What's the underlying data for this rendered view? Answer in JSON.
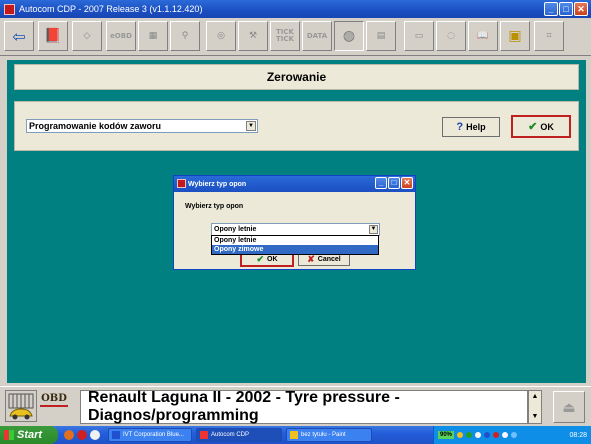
{
  "window": {
    "title": "Autocom CDP  -  2007 Release 3  (v1.1.12.420)",
    "minimize_label": "_",
    "maximize_label": "□",
    "close_label": "✕"
  },
  "toolbar": {
    "tools": [
      {
        "name": "back-arrow-icon",
        "label": "⇦"
      },
      {
        "name": "book-icon",
        "label": "📕"
      },
      {
        "name": "eraser-icon",
        "label": "◇"
      },
      {
        "name": "eobd-icon",
        "label": "eOBD"
      },
      {
        "name": "ecu-icon",
        "label": "▦"
      },
      {
        "name": "stamp-icon",
        "label": "⚲"
      },
      {
        "name": "disc-icon",
        "label": "◎"
      },
      {
        "name": "wrench-icon",
        "label": "⚒"
      },
      {
        "name": "tick-tick-icon",
        "label": "TICK TICK"
      },
      {
        "name": "data-icon",
        "label": "DATA"
      },
      {
        "name": "tire-icon",
        "label": "◍"
      },
      {
        "name": "keypad-icon",
        "label": "▤"
      },
      {
        "name": "save-icon",
        "label": "▭"
      },
      {
        "name": "cd-icon",
        "label": "◌"
      },
      {
        "name": "manual-icon",
        "label": "📖"
      },
      {
        "name": "chip-icon",
        "label": "▣"
      },
      {
        "name": "glasses-icon",
        "label": "⌗"
      }
    ]
  },
  "header": {
    "title": "Zerowanie"
  },
  "controls": {
    "combo_value": "Programowanie kodów zaworu",
    "help_label": "Help",
    "ok_label": "OK"
  },
  "dialog": {
    "title": "Wybierz typ opon",
    "prompt": "Wybierz typ opon",
    "selected_value": "Opony letnie",
    "options": [
      "Opony letnie",
      "Opony zimowe"
    ],
    "highlighted_index": 1,
    "ok_label": "OK",
    "cancel_label": "Cancel"
  },
  "status": {
    "obd_label": "OBD",
    "vehicle_text": "Renault Laguna II - 2002 - Tyre pressure - Diagnos/programming"
  },
  "taskbar": {
    "start_label": "Start",
    "tasks": [
      {
        "label": "IVT Corporation Blue...",
        "active": false
      },
      {
        "label": "Autocom CDP",
        "active": true
      },
      {
        "label": "bez tytułu - Paint",
        "active": false
      }
    ],
    "tray_percent": "90%",
    "clock": "08:28"
  },
  "colors": {
    "teal_background": "#008080",
    "titlebar_blue": "#1b4fc1",
    "ok_border_red": "#c02020",
    "check_green": "#1a8c22",
    "selection_blue": "#316ac5"
  }
}
